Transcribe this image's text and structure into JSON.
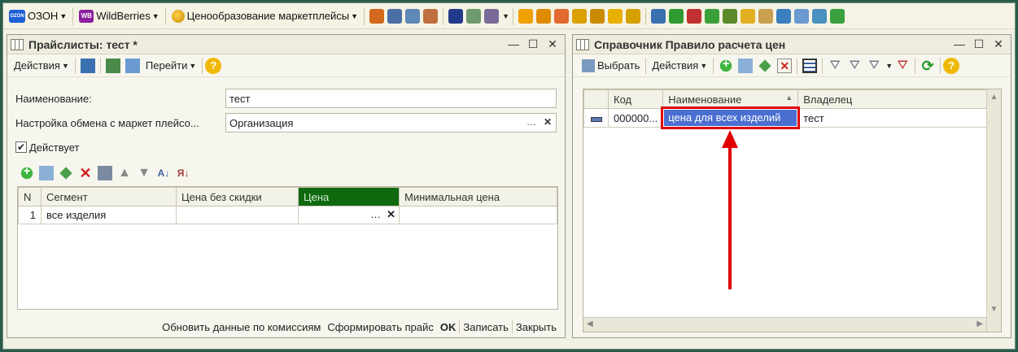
{
  "toolbar": {
    "ozon_label": "ОЗОН",
    "ozon_logo_text": "OZON",
    "wb_label": "WildBerries",
    "wb_logo_text": "WB",
    "pricing_label": "Ценообразование маркетплейсы"
  },
  "left_window": {
    "title": "Прайслисты: тест *",
    "actions_label": "Действия",
    "goto_label": "Перейти",
    "name_label": "Наименование:",
    "name_value": "тест",
    "exchange_label": "Настройка обмена с маркет плейсо...",
    "exchange_value": "Организация",
    "active_label": "Действует",
    "table": {
      "headers": [
        "N",
        "Сегмент",
        "Цена без скидки",
        "Цена",
        "Минимальная цена"
      ],
      "rows": [
        {
          "n": "1",
          "segment": "все изделия",
          "price_no_discount": "",
          "price": "",
          "min_price": ""
        }
      ]
    },
    "bottom": {
      "update_commissions": "Обновить данные по комиссиям",
      "form_price": "Сформировать прайс",
      "ok": "OK",
      "save": "Записать",
      "close": "Закрыть"
    }
  },
  "right_window": {
    "title": "Справочник Правило расчета цен",
    "select_label": "Выбрать",
    "actions_label": "Действия",
    "table": {
      "headers": [
        "Код",
        "Наименование",
        "Владелец"
      ],
      "rows": [
        {
          "code": "000000...",
          "name": "цена для всех изделий",
          "owner": "тест"
        }
      ]
    }
  },
  "colors": {
    "price_header_bg": "#0f6a0f",
    "highlight_red": "#e00000",
    "selected_cell_bg": "#4a6fd1"
  }
}
